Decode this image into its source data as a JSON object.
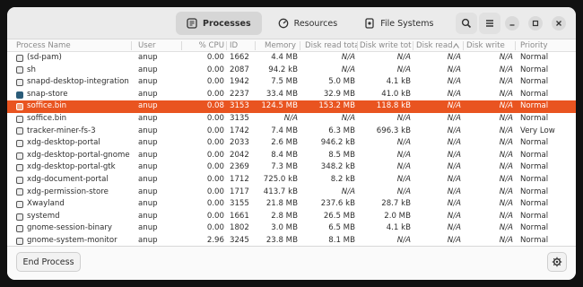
{
  "tabs": [
    {
      "label": "Processes",
      "icon": "processes-icon",
      "active": true
    },
    {
      "label": "Resources",
      "icon": "resources-icon",
      "active": false
    },
    {
      "label": "File Systems",
      "icon": "file-systems-icon",
      "active": false
    }
  ],
  "columns": [
    "Process Name",
    "User",
    "% CPU",
    "ID",
    "Memory",
    "Disk read tota",
    "Disk write tot",
    "Disk read",
    "Disk write",
    "Priority"
  ],
  "processes": [
    {
      "name": "(sd-pam)",
      "user": "anup",
      "cpu": "0.00",
      "id": "1662",
      "memory": "4.4 MB",
      "disk_read_total": "N/A",
      "disk_write_total": "N/A",
      "disk_read": "N/A",
      "disk_write": "N/A",
      "priority": "Normal"
    },
    {
      "name": "sh",
      "user": "anup",
      "cpu": "0.00",
      "id": "2087",
      "memory": "94.2 kB",
      "disk_read_total": "N/A",
      "disk_write_total": "N/A",
      "disk_read": "N/A",
      "disk_write": "N/A",
      "priority": "Normal"
    },
    {
      "name": "snapd-desktop-integration",
      "user": "anup",
      "cpu": "0.00",
      "id": "1942",
      "memory": "7.5 MB",
      "disk_read_total": "5.0 MB",
      "disk_write_total": "4.1 kB",
      "disk_read": "N/A",
      "disk_write": "N/A",
      "priority": "Normal"
    },
    {
      "name": "snap-store",
      "user": "anup",
      "cpu": "0.00",
      "id": "2237",
      "memory": "33.4 MB",
      "disk_read_total": "32.9 MB",
      "disk_write_total": "41.0 kB",
      "disk_read": "N/A",
      "disk_write": "N/A",
      "priority": "Normal"
    },
    {
      "name": "soffice.bin",
      "user": "anup",
      "cpu": "0.08",
      "id": "3153",
      "memory": "124.5 MB",
      "disk_read_total": "153.2 MB",
      "disk_write_total": "118.8 kB",
      "disk_read": "N/A",
      "disk_write": "N/A",
      "priority": "Normal"
    },
    {
      "name": "soffice.bin",
      "user": "anup",
      "cpu": "0.00",
      "id": "3135",
      "memory": "N/A",
      "disk_read_total": "N/A",
      "disk_write_total": "N/A",
      "disk_read": "N/A",
      "disk_write": "N/A",
      "priority": "Normal"
    },
    {
      "name": "tracker-miner-fs-3",
      "user": "anup",
      "cpu": "0.00",
      "id": "1742",
      "memory": "7.4 MB",
      "disk_read_total": "6.3 MB",
      "disk_write_total": "696.3 kB",
      "disk_read": "N/A",
      "disk_write": "N/A",
      "priority": "Very Low"
    },
    {
      "name": "xdg-desktop-portal",
      "user": "anup",
      "cpu": "0.00",
      "id": "2033",
      "memory": "2.6 MB",
      "disk_read_total": "946.2 kB",
      "disk_write_total": "N/A",
      "disk_read": "N/A",
      "disk_write": "N/A",
      "priority": "Normal"
    },
    {
      "name": "xdg-desktop-portal-gnome",
      "user": "anup",
      "cpu": "0.00",
      "id": "2042",
      "memory": "8.4 MB",
      "disk_read_total": "8.5 MB",
      "disk_write_total": "N/A",
      "disk_read": "N/A",
      "disk_write": "N/A",
      "priority": "Normal"
    },
    {
      "name": "xdg-desktop-portal-gtk",
      "user": "anup",
      "cpu": "0.00",
      "id": "2369",
      "memory": "7.3 MB",
      "disk_read_total": "348.2 kB",
      "disk_write_total": "N/A",
      "disk_read": "N/A",
      "disk_write": "N/A",
      "priority": "Normal"
    },
    {
      "name": "xdg-document-portal",
      "user": "anup",
      "cpu": "0.00",
      "id": "1712",
      "memory": "725.0 kB",
      "disk_read_total": "8.2 kB",
      "disk_write_total": "N/A",
      "disk_read": "N/A",
      "disk_write": "N/A",
      "priority": "Normal"
    },
    {
      "name": "xdg-permission-store",
      "user": "anup",
      "cpu": "0.00",
      "id": "1717",
      "memory": "413.7 kB",
      "disk_read_total": "N/A",
      "disk_write_total": "N/A",
      "disk_read": "N/A",
      "disk_write": "N/A",
      "priority": "Normal"
    },
    {
      "name": "Xwayland",
      "user": "anup",
      "cpu": "0.00",
      "id": "3155",
      "memory": "21.8 MB",
      "disk_read_total": "237.6 kB",
      "disk_write_total": "28.7 kB",
      "disk_read": "N/A",
      "disk_write": "N/A",
      "priority": "Normal"
    },
    {
      "name": "systemd",
      "user": "anup",
      "cpu": "0.00",
      "id": "1661",
      "memory": "2.8 MB",
      "disk_read_total": "26.5 MB",
      "disk_write_total": "2.0 MB",
      "disk_read": "N/A",
      "disk_write": "N/A",
      "priority": "Normal"
    },
    {
      "name": "gnome-session-binary",
      "user": "anup",
      "cpu": "0.00",
      "id": "1802",
      "memory": "3.0 MB",
      "disk_read_total": "6.5 MB",
      "disk_write_total": "4.1 kB",
      "disk_read": "N/A",
      "disk_write": "N/A",
      "priority": "Normal"
    },
    {
      "name": "gnome-system-monitor",
      "user": "anup",
      "cpu": "2.96",
      "id": "3245",
      "memory": "23.8 MB",
      "disk_read_total": "8.1 MB",
      "disk_write_total": "N/A",
      "disk_read": "N/A",
      "disk_write": "N/A",
      "priority": "Normal"
    }
  ],
  "selected_process_id": "3153",
  "footer": {
    "end_process_label": "End Process"
  },
  "colors": {
    "selection": "#e95420"
  }
}
